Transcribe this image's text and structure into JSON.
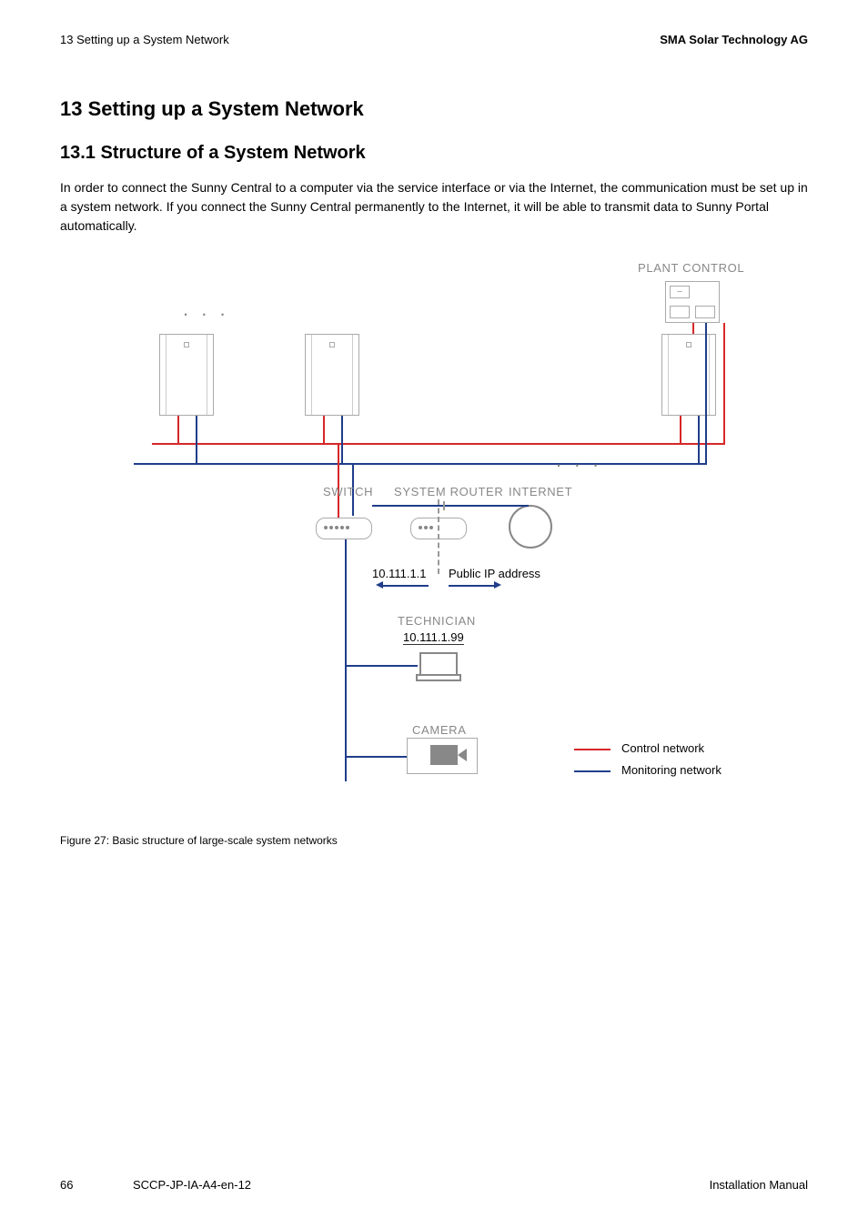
{
  "header": {
    "left": "13  Setting up a System Network",
    "right": "SMA Solar Technology AG"
  },
  "h1": "13 Setting up a System Network",
  "h2": "13.1 Structure of a System Network",
  "para": "In order to connect the Sunny Central to a computer via the service interface or via the Internet, the communication must be set up in a system network. If you connect the Sunny Central permanently to the Internet, it will be able to transmit data to Sunny Portal automatically.",
  "diagram": {
    "plant_control": "PLANT CONTROL",
    "switch": "SWITCH",
    "system_router": "SYSTEM ROUTER",
    "internet": "INTERNET",
    "ip_left": "10.111.1.1",
    "ip_right": "Public IP address",
    "technician": "TECHNICIAN",
    "technician_ip": "10.111.1.99",
    "camera": "CAMERA",
    "legend_control": "Control network",
    "legend_monitor": "Monitoring network"
  },
  "caption": "Figure 27:  Basic structure of large-scale system networks",
  "footer": {
    "page": "66",
    "doc": "SCCP-JP-IA-A4-en-12",
    "right": "Installation Manual"
  }
}
